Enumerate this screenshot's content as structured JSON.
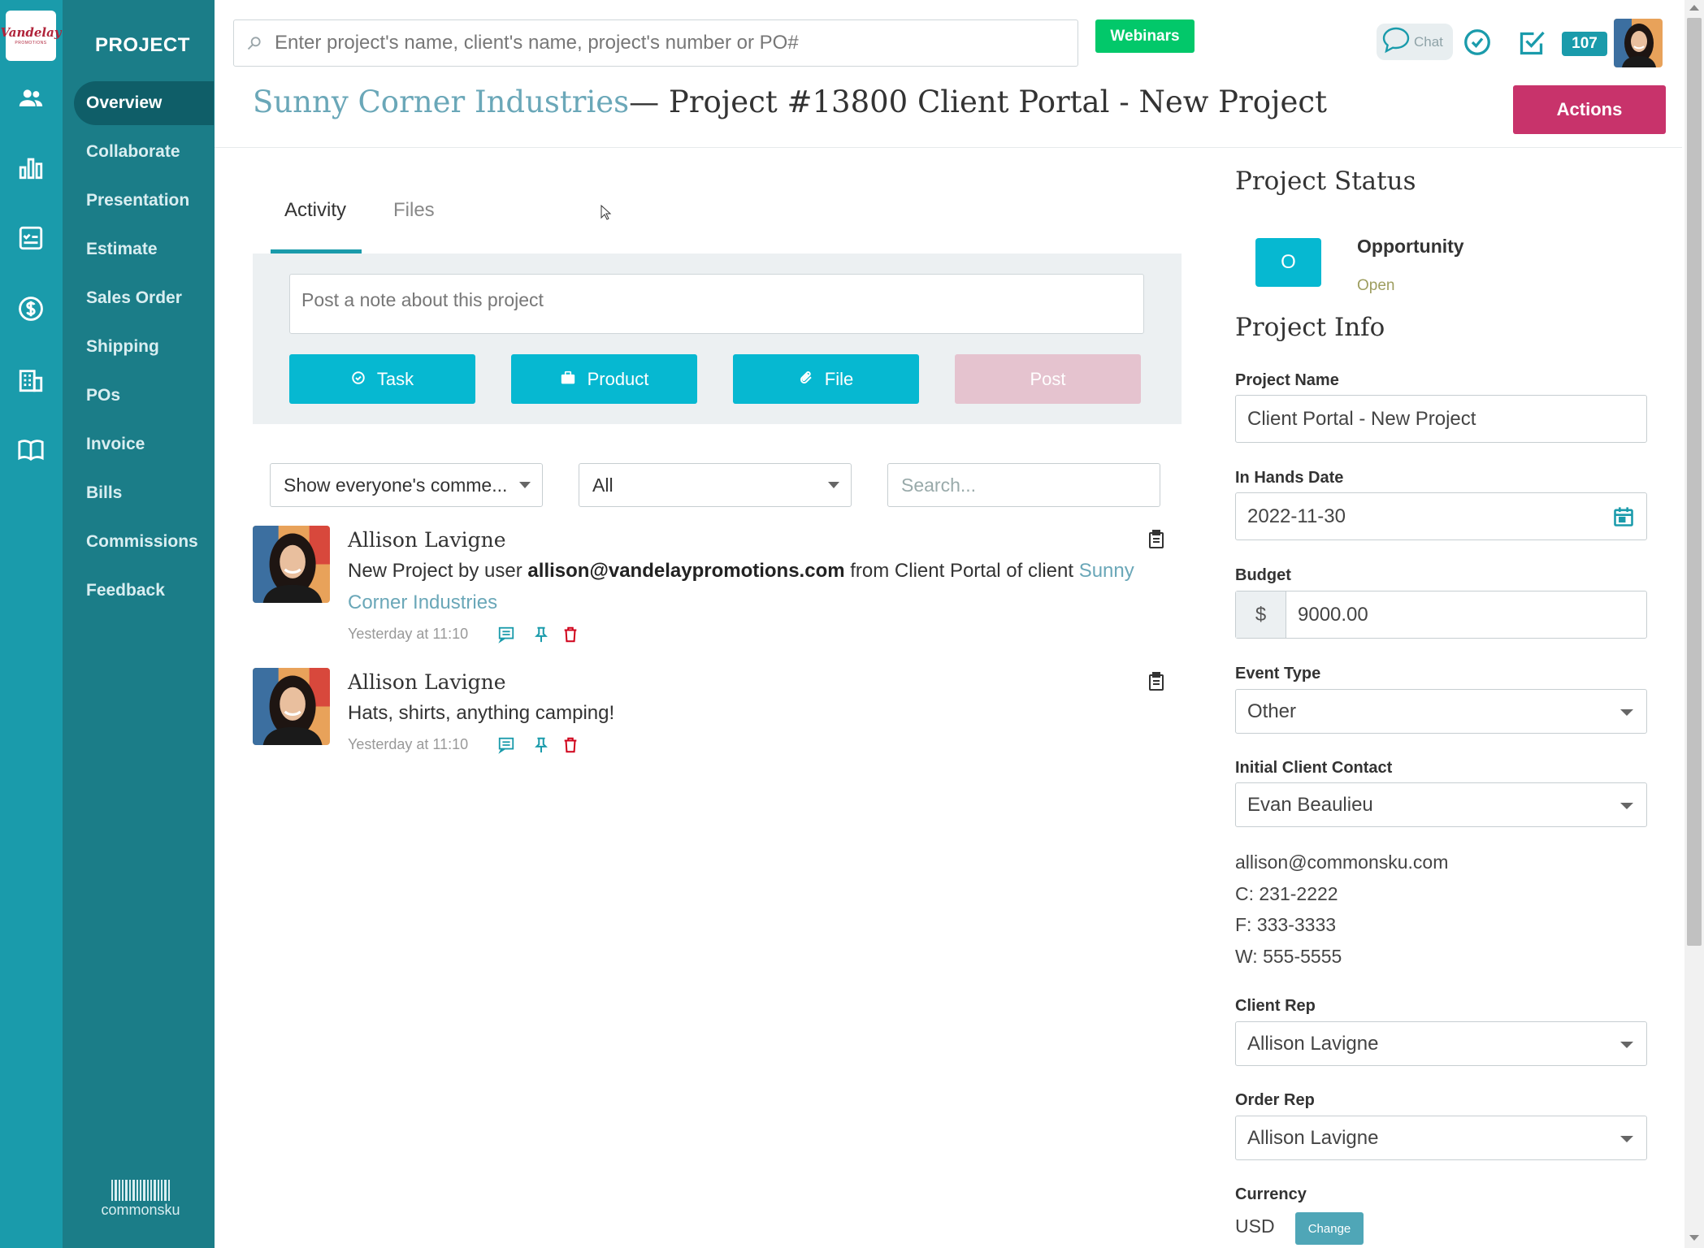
{
  "brand": {
    "logo_line1": "Vandelay",
    "logo_line2": "PROMOTIONS",
    "footer_logo": "commonsku"
  },
  "sidebar": {
    "title": "PROJECT",
    "items": [
      {
        "label": "Overview",
        "active": true
      },
      {
        "label": "Collaborate"
      },
      {
        "label": "Presentation"
      },
      {
        "label": "Estimate"
      },
      {
        "label": "Sales Order"
      },
      {
        "label": "Shipping"
      },
      {
        "label": "POs"
      },
      {
        "label": "Invoice"
      },
      {
        "label": "Bills"
      },
      {
        "label": "Commissions"
      },
      {
        "label": "Feedback"
      }
    ],
    "rail_icons": [
      "people-icon",
      "bar-chart-icon",
      "checklist-icon",
      "dollar-icon",
      "building-icon",
      "book-icon"
    ]
  },
  "header": {
    "search_placeholder": "Enter project's name, client's name, project's number or PO#",
    "webinars_label": "Webinars",
    "chat_label": "Chat",
    "notification_count": "107",
    "icons": [
      "chat-icon",
      "clock-check-icon",
      "task-check-icon",
      "user-avatar"
    ]
  },
  "title": {
    "client": "Sunny Corner Industries",
    "project": "— Project #13800 Client Portal - New Project",
    "actions_label": "Actions"
  },
  "tabs": [
    {
      "label": "Activity",
      "active": true
    },
    {
      "label": "Files"
    }
  ],
  "composer": {
    "placeholder": "Post a note about this project",
    "buttons": {
      "task": "Task",
      "product": "Product",
      "file": "File",
      "post": "Post"
    }
  },
  "filters": {
    "comments_value": "Show everyone's comme...",
    "type_value": "All",
    "search_placeholder": "Search..."
  },
  "activity": [
    {
      "author": "Allison Lavigne",
      "text_prefix": "New Project by user ",
      "text_email": "allison@vandelaypromotions.com",
      "text_middle": " from Client Portal of client ",
      "text_link": "Sunny Corner Industries",
      "time": "Yesterday at 11:10"
    },
    {
      "author": "Allison Lavigne",
      "text": "Hats, shirts, anything camping!",
      "time": "Yesterday at 11:10"
    }
  ],
  "status": {
    "heading": "Project Status",
    "badge": "O",
    "label": "Opportunity",
    "sub": "Open"
  },
  "info": {
    "heading": "Project Info",
    "project_name_label": "Project Name",
    "project_name": "Client Portal - New Project",
    "in_hands_label": "In Hands Date",
    "in_hands": "2022-11-30",
    "budget_label": "Budget",
    "budget_currency": "$",
    "budget": "9000.00",
    "event_type_label": "Event Type",
    "event_type": "Other",
    "contact_label": "Initial Client Contact",
    "contact": "Evan Beaulieu",
    "contact_email": "allison@commonsku.com",
    "contact_cell": "C: 231-2222",
    "contact_fax": "F: 333-3333",
    "contact_work": "W: 555-5555",
    "client_rep_label": "Client Rep",
    "client_rep": "Allison Lavigne",
    "order_rep_label": "Order Rep",
    "order_rep": "Allison Lavigne",
    "currency_label": "Currency",
    "currency": "USD",
    "change_label": "Change"
  },
  "colors": {
    "rail": "#1a9bab",
    "sidebar": "#1b7d88",
    "accent": "#06b8d1",
    "actions": "#c8336b",
    "webinars": "#02c86a"
  }
}
